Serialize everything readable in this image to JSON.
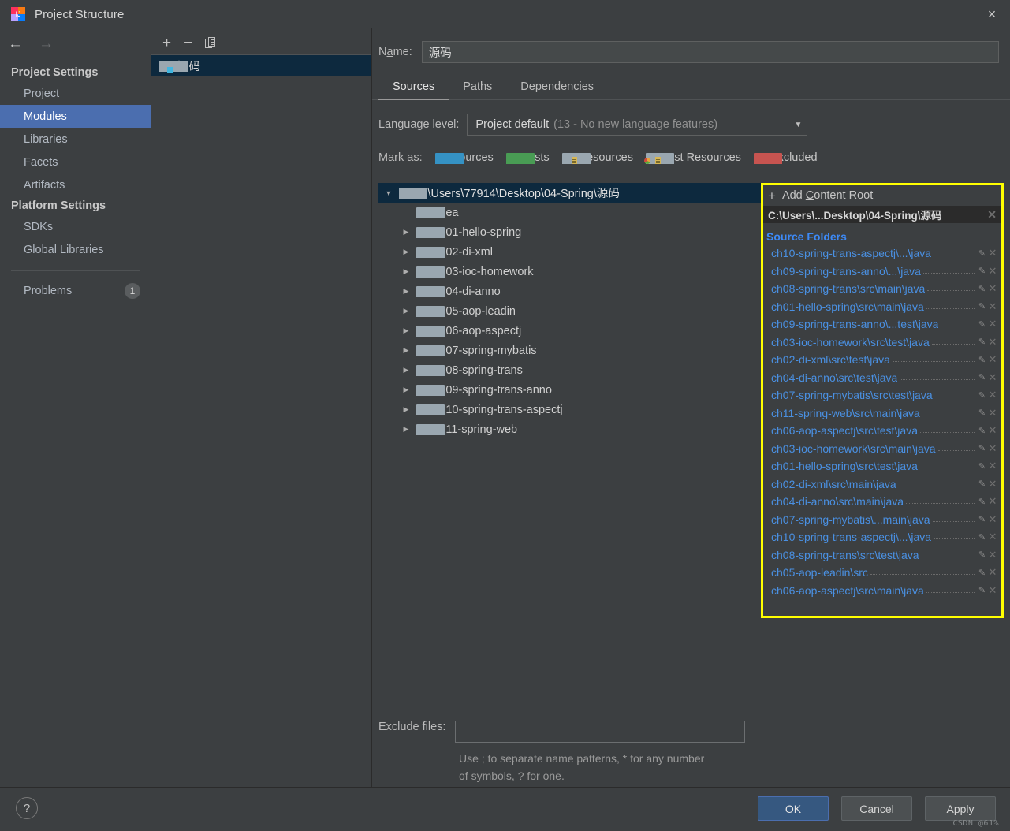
{
  "window": {
    "title": "Project Structure",
    "app_icon": "intellij-idea-icon",
    "close_label": "×"
  },
  "sidebar": {
    "back_icon": "←",
    "forward_icon": "→",
    "groups": [
      {
        "label": "Project Settings",
        "items": [
          {
            "label": "Project",
            "selected": false
          },
          {
            "label": "Modules",
            "selected": true
          },
          {
            "label": "Libraries",
            "selected": false
          },
          {
            "label": "Facets",
            "selected": false
          },
          {
            "label": "Artifacts",
            "selected": false
          }
        ]
      },
      {
        "label": "Platform Settings",
        "items": [
          {
            "label": "SDKs",
            "selected": false
          },
          {
            "label": "Global Libraries",
            "selected": false
          }
        ]
      }
    ],
    "problems": {
      "label": "Problems",
      "count": "1"
    }
  },
  "modules_panel": {
    "toolbar": {
      "add": "+",
      "remove": "−",
      "copy_icon": "copy-icon"
    },
    "items": [
      {
        "label": "源码",
        "selected": true
      }
    ]
  },
  "details": {
    "name_label": "Name:",
    "name_value": "源码",
    "tabs": [
      {
        "label": "Sources",
        "active": true
      },
      {
        "label": "Paths",
        "active": false
      },
      {
        "label": "Dependencies",
        "active": false
      }
    ],
    "language_level_label": "Language level:",
    "language_level_value": "Project default",
    "language_level_detail": "(13 - No new language features)",
    "mark_as_label": "Mark as:",
    "mark_as": [
      {
        "label": "Sources",
        "color": "#3592c4",
        "kind": "plain"
      },
      {
        "label": "Tests",
        "color": "#499c54",
        "kind": "plain"
      },
      {
        "label": "Resources",
        "color": "#9aa7b0",
        "kind": "res"
      },
      {
        "label": "Test Resources",
        "color": "#9aa7b0",
        "kind": "testres"
      },
      {
        "label": "Excluded",
        "color": "#c75450",
        "kind": "plain"
      }
    ],
    "tree": {
      "root": {
        "label": "C:\\Users\\77914\\Desktop\\04-Spring\\源码",
        "expanded": true
      },
      "children": [
        {
          "label": ".idea",
          "has_toggle": false
        },
        {
          "label": "ch01-hello-spring",
          "has_toggle": true
        },
        {
          "label": "ch02-di-xml",
          "has_toggle": true
        },
        {
          "label": "ch03-ioc-homework",
          "has_toggle": true
        },
        {
          "label": "ch04-di-anno",
          "has_toggle": true
        },
        {
          "label": "ch05-aop-leadin",
          "has_toggle": true
        },
        {
          "label": "ch06-aop-aspectj",
          "has_toggle": true
        },
        {
          "label": "ch07-spring-mybatis",
          "has_toggle": true
        },
        {
          "label": "ch08-spring-trans",
          "has_toggle": true
        },
        {
          "label": "ch09-spring-trans-anno",
          "has_toggle": true
        },
        {
          "label": "ch10-spring-trans-aspectj",
          "has_toggle": true
        },
        {
          "label": "ch11-spring-web",
          "has_toggle": true
        }
      ]
    },
    "source_panel": {
      "highlight_color": "#ffff00",
      "add_content_root": "Add Content Root",
      "content_root": "C:\\Users\\...Desktop\\04-Spring\\源码",
      "source_folders_label": "Source Folders",
      "source_folders": [
        "ch10-spring-trans-aspectj\\...\\java",
        "ch09-spring-trans-anno\\...\\java",
        "ch08-spring-trans\\src\\main\\java",
        "ch01-hello-spring\\src\\main\\java",
        "ch09-spring-trans-anno\\...test\\java",
        "ch03-ioc-homework\\src\\test\\java",
        "ch02-di-xml\\src\\test\\java",
        "ch04-di-anno\\src\\test\\java",
        "ch07-spring-mybatis\\src\\test\\java",
        "ch11-spring-web\\src\\main\\java",
        "ch06-aop-aspectj\\src\\test\\java",
        "ch03-ioc-homework\\src\\main\\java",
        "ch01-hello-spring\\src\\test\\java",
        "ch02-di-xml\\src\\main\\java",
        "ch04-di-anno\\src\\main\\java",
        "ch07-spring-mybatis\\...main\\java",
        "ch10-spring-trans-aspectj\\...\\java",
        "ch08-spring-trans\\src\\test\\java",
        "ch05-aop-leadin\\src",
        "ch06-aop-aspectj\\src\\main\\java"
      ]
    },
    "exclude_label": "Exclude files:",
    "exclude_value": "",
    "exclude_hint_1": "Use ; to separate name patterns, * for any number",
    "exclude_hint_2": "of symbols, ? for one."
  },
  "footer": {
    "help": "?",
    "ok": "OK",
    "cancel": "Cancel",
    "apply": "Apply",
    "watermark": "CSDN @61%"
  }
}
